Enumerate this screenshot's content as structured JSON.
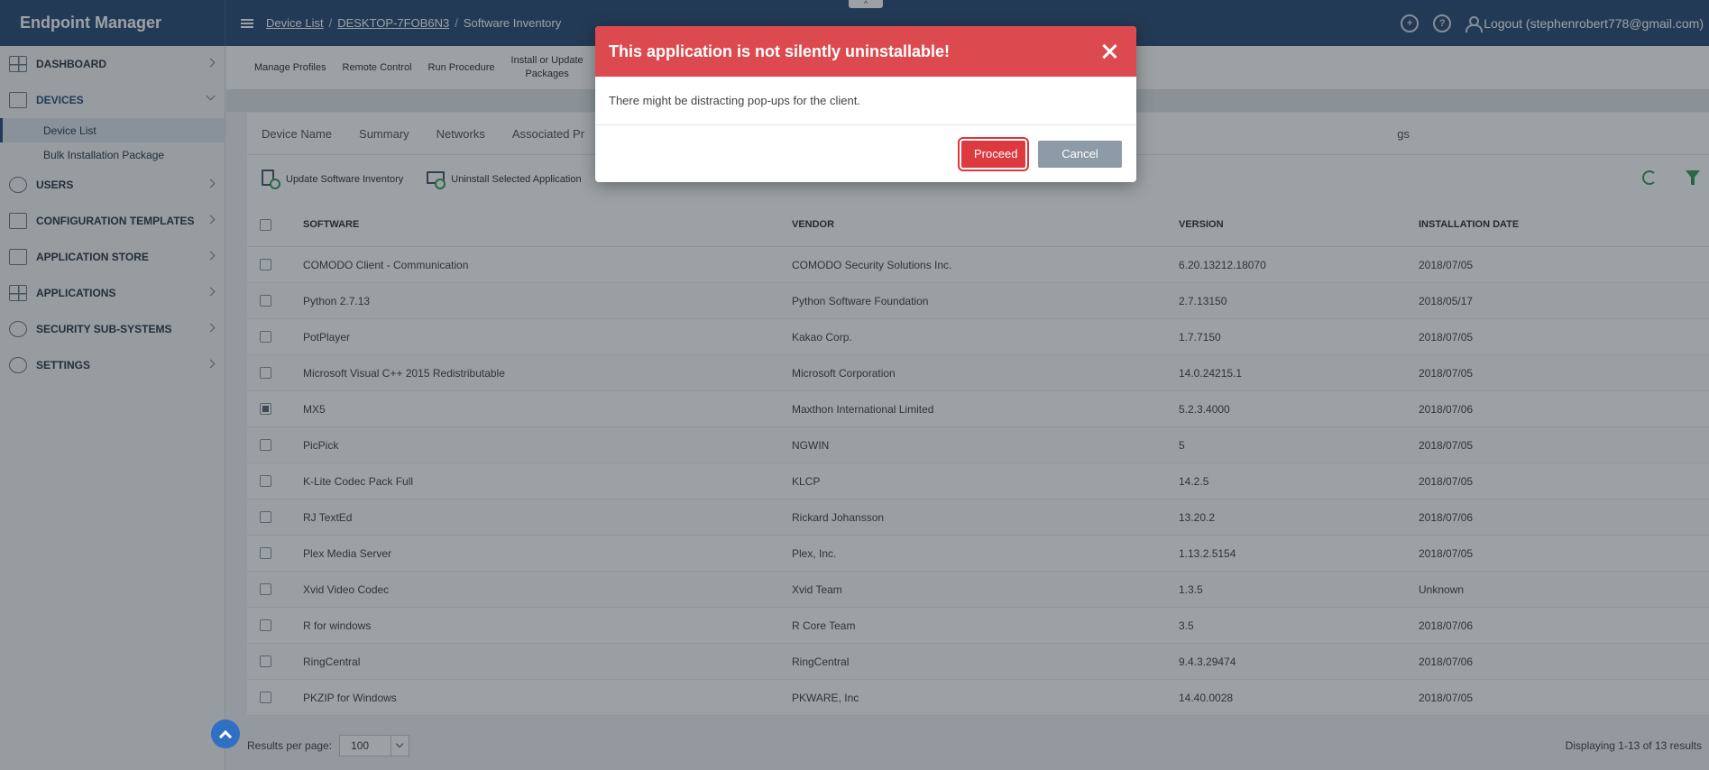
{
  "header": {
    "brand": "Endpoint Manager",
    "breadcrumbs": [
      "Device List",
      "DESKTOP-7FOB6N3",
      "Software Inventory"
    ],
    "logout_label": "Logout (stephenrobert778@gmail.com)",
    "collapse_tab": "^"
  },
  "sidebar": {
    "items": [
      {
        "label": "DASHBOARD"
      },
      {
        "label": "DEVICES"
      },
      {
        "label": "USERS"
      },
      {
        "label": "CONFIGURATION TEMPLATES"
      },
      {
        "label": "APPLICATION STORE"
      },
      {
        "label": "APPLICATIONS"
      },
      {
        "label": "SECURITY SUB-SYSTEMS"
      },
      {
        "label": "SETTINGS"
      }
    ],
    "devices_sub": [
      "Device List",
      "Bulk Installation Package"
    ]
  },
  "actions": [
    "Manage Profiles",
    "Remote Control",
    "Run Procedure",
    "Install or Update",
    "Packages"
  ],
  "tabs": [
    "Device Name",
    "Summary",
    "Networks",
    "Associated Pr",
    "gs"
  ],
  "toolbar": {
    "update_label": "Update Software Inventory",
    "uninstall_label": "Uninstall Selected Application"
  },
  "table": {
    "headers": [
      "SOFTWARE",
      "VENDOR",
      "VERSION",
      "INSTALLATION DATE"
    ],
    "rows": [
      [
        "COMODO Client - Communication",
        "COMODO Security Solutions Inc.",
        "6.20.13212.18070",
        "2018/07/05"
      ],
      [
        "Python 2.7.13",
        "Python Software Foundation",
        "2.7.13150",
        "2018/05/17"
      ],
      [
        "PotPlayer",
        "Kakao Corp.",
        "1.7.7150",
        "2018/07/05"
      ],
      [
        "Microsoft Visual C++ 2015 Redistributable",
        "Microsoft Corporation",
        "14.0.24215.1",
        "2018/07/05"
      ],
      [
        "MX5",
        "Maxthon International Limited",
        "5.2.3.4000",
        "2018/07/06"
      ],
      [
        "PicPick",
        "NGWIN",
        "5",
        "2018/07/05"
      ],
      [
        "K-Lite Codec Pack Full",
        "KLCP",
        "14.2.5",
        "2018/07/05"
      ],
      [
        "RJ TextEd",
        "Rickard Johansson",
        "13.20.2",
        "2018/07/06"
      ],
      [
        "Plex Media Server",
        "Plex, Inc.",
        "1.13.2.5154",
        "2018/07/05"
      ],
      [
        "Xvid Video Codec",
        "Xvid Team",
        "1.3.5",
        "Unknown"
      ],
      [
        "R for windows",
        "R Core Team",
        "3.5",
        "2018/07/06"
      ],
      [
        "RingCentral",
        "RingCentral",
        "9.4.3.29474",
        "2018/07/06"
      ],
      [
        "PKZIP for Windows",
        "PKWARE, Inc",
        "14.40.0028",
        "2018/07/05"
      ]
    ],
    "checked_row": 4
  },
  "footer": {
    "results_label": "Results per page:",
    "per_page": "100",
    "displaying": "Displaying 1-13 of 13 results"
  },
  "dialog": {
    "title": "This application is not silently uninstallable!",
    "message": "There might be distracting pop-ups for the client.",
    "proceed": "Proceed",
    "cancel": "Cancel"
  },
  "colors": {
    "header_bg": "#2f4f77",
    "dialog_header": "#dc4a4f",
    "proceed_bg": "#dc3a3f",
    "cancel_bg": "#8d9aa8",
    "accent_green": "#3a9a5a"
  }
}
